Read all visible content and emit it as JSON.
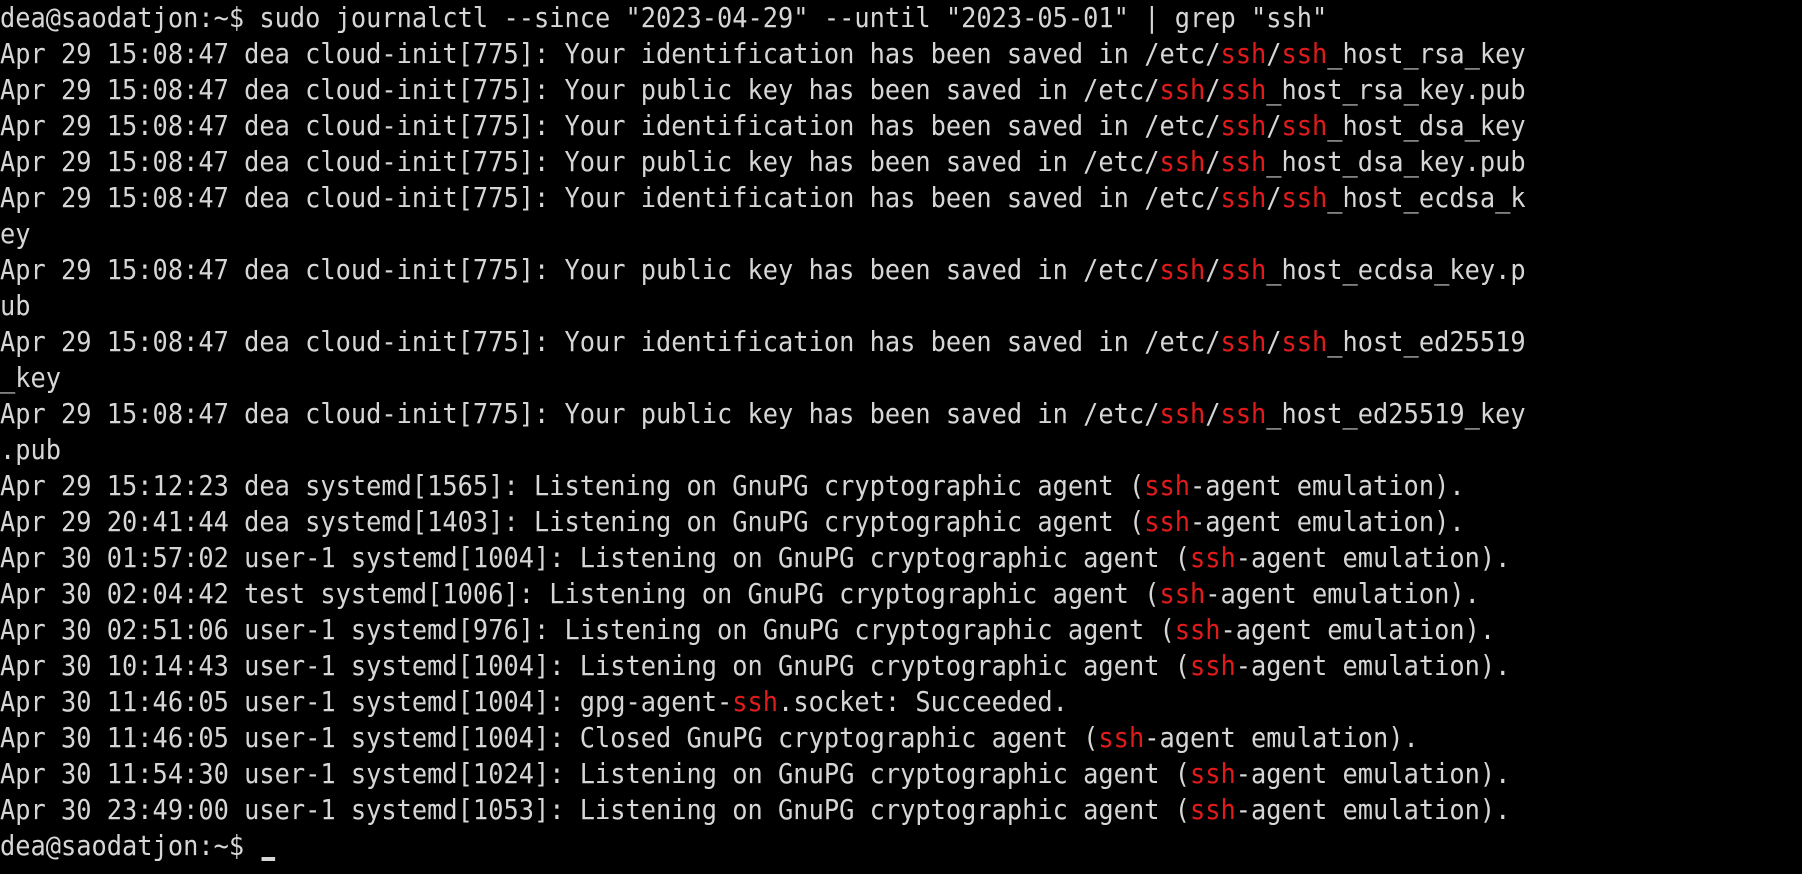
{
  "colors": {
    "background": "#000000",
    "text": "#d6d6d6",
    "grep_match": "#e01b1b"
  },
  "terminal": {
    "highlight_term": "ssh",
    "lines": [
      "dea@saodatjon:~$ sudo journalctl --since \"2023-04-29\" --until \"2023-05-01\" | grep \"ssh\"",
      "Apr 29 15:08:47 dea cloud-init[775]: Your identification has been saved in /etc/ssh/ssh_host_rsa_key",
      "Apr 29 15:08:47 dea cloud-init[775]: Your public key has been saved in /etc/ssh/ssh_host_rsa_key.pub",
      "Apr 29 15:08:47 dea cloud-init[775]: Your identification has been saved in /etc/ssh/ssh_host_dsa_key",
      "Apr 29 15:08:47 dea cloud-init[775]: Your public key has been saved in /etc/ssh/ssh_host_dsa_key.pub",
      "Apr 29 15:08:47 dea cloud-init[775]: Your identification has been saved in /etc/ssh/ssh_host_ecdsa_k",
      "ey",
      "Apr 29 15:08:47 dea cloud-init[775]: Your public key has been saved in /etc/ssh/ssh_host_ecdsa_key.p",
      "ub",
      "Apr 29 15:08:47 dea cloud-init[775]: Your identification has been saved in /etc/ssh/ssh_host_ed25519",
      "_key",
      "Apr 29 15:08:47 dea cloud-init[775]: Your public key has been saved in /etc/ssh/ssh_host_ed25519_key",
      ".pub",
      "Apr 29 15:12:23 dea systemd[1565]: Listening on GnuPG cryptographic agent (ssh-agent emulation).",
      "Apr 29 20:41:44 dea systemd[1403]: Listening on GnuPG cryptographic agent (ssh-agent emulation).",
      "Apr 30 01:57:02 user-1 systemd[1004]: Listening on GnuPG cryptographic agent (ssh-agent emulation).",
      "Apr 30 02:04:42 test systemd[1006]: Listening on GnuPG cryptographic agent (ssh-agent emulation).",
      "Apr 30 02:51:06 user-1 systemd[976]: Listening on GnuPG cryptographic agent (ssh-agent emulation).",
      "Apr 30 10:14:43 user-1 systemd[1004]: Listening on GnuPG cryptographic agent (ssh-agent emulation).",
      "Apr 30 11:46:05 user-1 systemd[1004]: gpg-agent-ssh.socket: Succeeded.",
      "Apr 30 11:46:05 user-1 systemd[1004]: Closed GnuPG cryptographic agent (ssh-agent emulation).",
      "Apr 30 11:54:30 user-1 systemd[1024]: Listening on GnuPG cryptographic agent (ssh-agent emulation).",
      "Apr 30 23:49:00 user-1 systemd[1053]: Listening on GnuPG cryptographic agent (ssh-agent emulation)."
    ],
    "prompt": "dea@saodatjon:~$ "
  }
}
